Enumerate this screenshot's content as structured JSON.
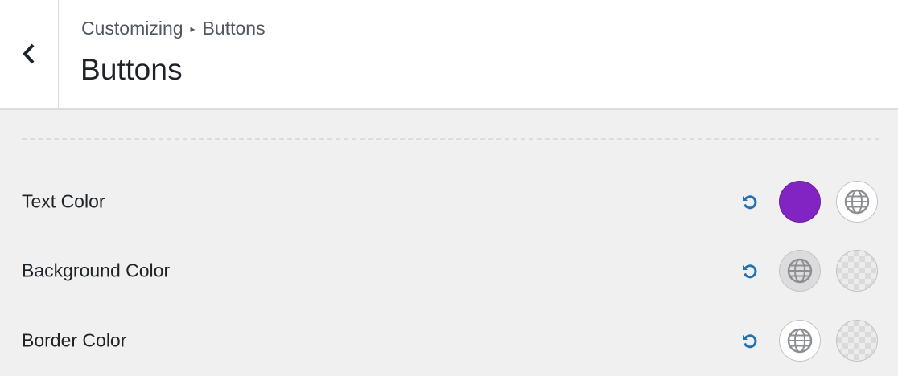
{
  "header": {
    "breadcrumb_parent": "Customizing",
    "breadcrumb_separator": "▸",
    "breadcrumb_current": "Buttons",
    "title": "Buttons",
    "back_icon": "chevron-left-icon"
  },
  "rows": [
    {
      "label": "Text Color",
      "reset_icon": "undo-icon",
      "swatch1": {
        "type": "color",
        "color": "#8224c4"
      },
      "swatch2": {
        "type": "global",
        "icon": "globe-icon"
      }
    },
    {
      "label": "Background Color",
      "reset_icon": "undo-icon",
      "swatch1": {
        "type": "global",
        "icon": "globe-icon"
      },
      "swatch2": {
        "type": "transparent"
      }
    },
    {
      "label": "Border Color",
      "reset_icon": "undo-icon",
      "swatch1": {
        "type": "global",
        "icon": "globe-icon"
      },
      "swatch2": {
        "type": "transparent"
      }
    }
  ],
  "colors": {
    "accent": "#2271b1",
    "text_color_swatch": "#8224c4"
  }
}
